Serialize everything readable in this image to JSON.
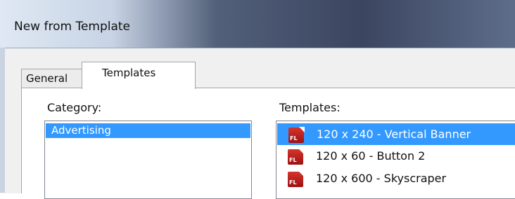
{
  "window": {
    "title": "New from Template"
  },
  "tabs": [
    {
      "label": "General",
      "active": false
    },
    {
      "label": "Templates",
      "active": true
    }
  ],
  "category": {
    "label": "Category:",
    "items": [
      {
        "label": "Advertising",
        "selected": true
      }
    ]
  },
  "templates": {
    "label": "Templates:",
    "items": [
      {
        "label": "120 x 240 - Vertical Banner",
        "icon": "fl-file-icon",
        "selected": true
      },
      {
        "label": "120 x 60 - Button 2",
        "icon": "fl-file-icon",
        "selected": false
      },
      {
        "label": "120 x 600 - Skyscraper",
        "icon": "fl-file-icon",
        "selected": false
      }
    ],
    "icon_text": "FL"
  },
  "colors": {
    "selection": "#3399ff",
    "icon_red": "#c42a22"
  }
}
